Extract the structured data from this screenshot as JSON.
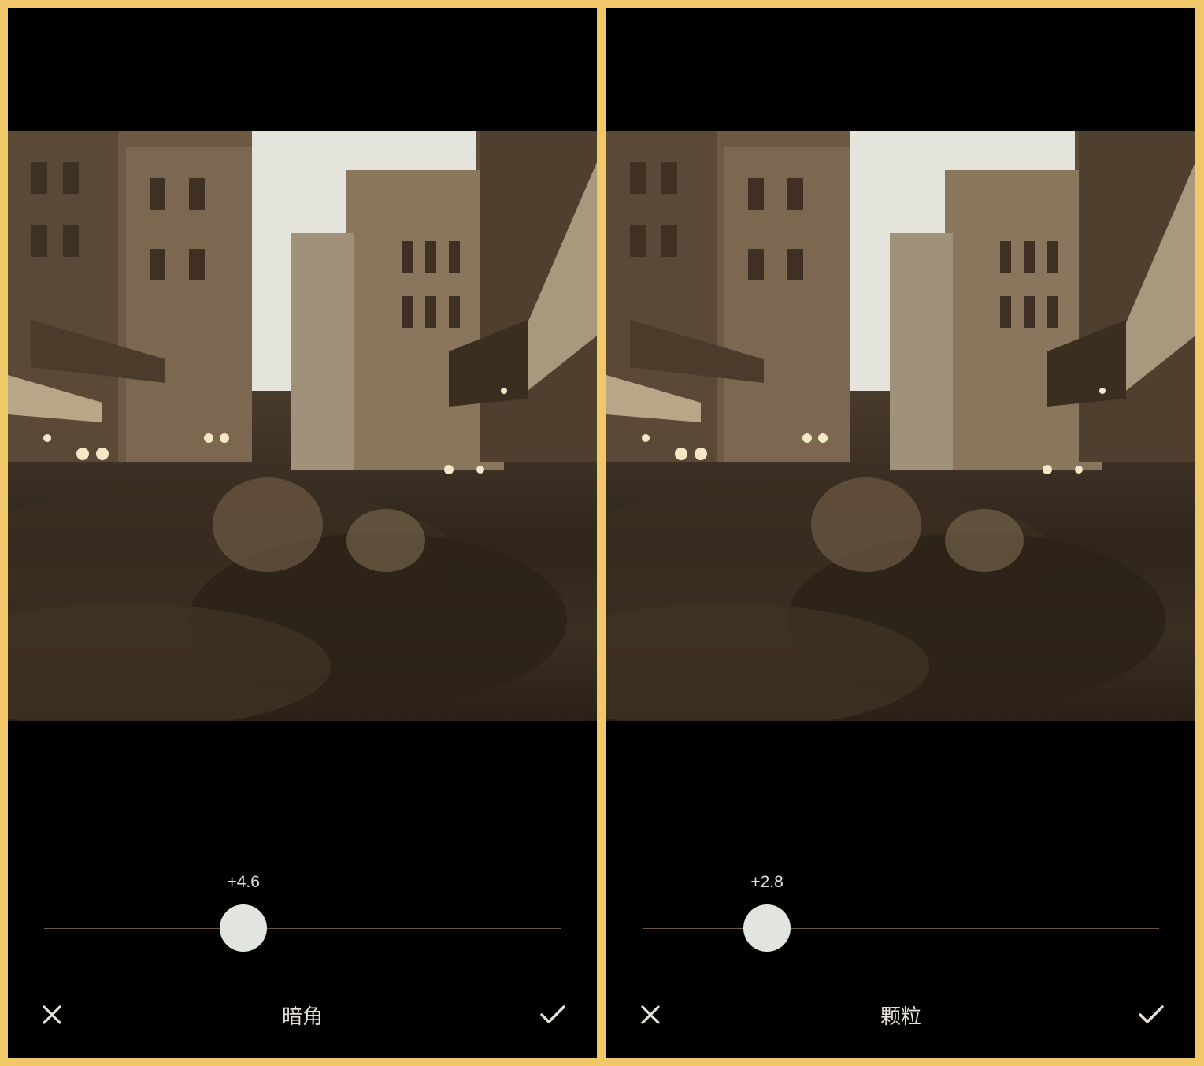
{
  "panels": [
    {
      "tool_label": "暗角",
      "value_label": "+4.6",
      "slider_fraction": 0.386,
      "cancel_icon": "close-icon",
      "confirm_icon": "check-icon"
    },
    {
      "tool_label": "颗粒",
      "value_label": "+2.8",
      "slider_fraction": 0.241,
      "cancel_icon": "close-icon",
      "confirm_icon": "check-icon"
    }
  ],
  "colors": {
    "border": "#f0c869",
    "background": "#000000",
    "thumb": "#e2e4df",
    "track": "#6b5838",
    "text": "#e6e2d8"
  }
}
